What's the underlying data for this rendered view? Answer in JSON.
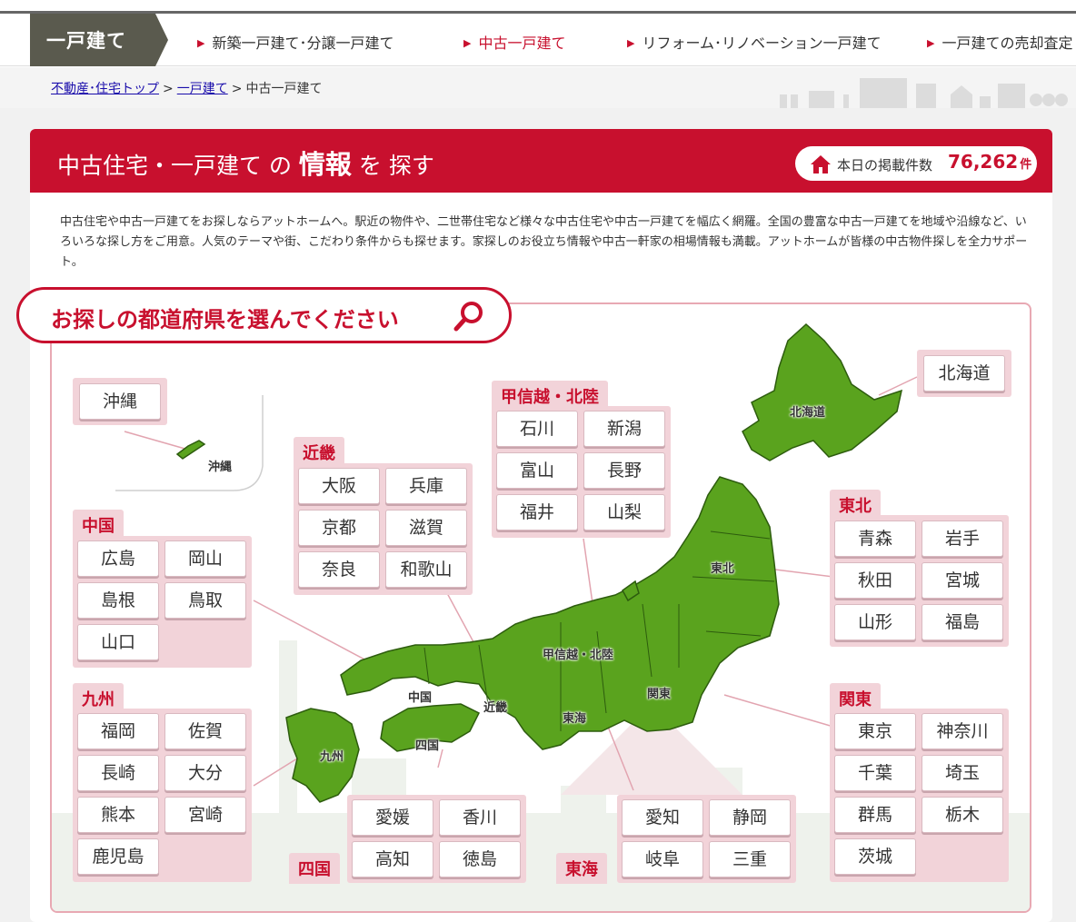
{
  "nav": {
    "title": "一戸建て",
    "links": [
      {
        "label": "新築一戸建て･分譲一戸建て",
        "active": false
      },
      {
        "label": "中古一戸建て",
        "active": true
      },
      {
        "label": "リフォーム･リノベーション一戸建て",
        "active": false
      },
      {
        "label": "一戸建ての売却査定",
        "active": false
      }
    ]
  },
  "breadcrumb": {
    "items": [
      "不動産･住宅トップ",
      "一戸建て",
      "中古一戸建て"
    ],
    "separator": ">"
  },
  "header": {
    "title_part1": "中古住宅・一戸建て の ",
    "title_big": "情報",
    "title_part2": " を 探す",
    "count_label": "本日の掲載件数",
    "count_value": "76,262",
    "count_unit": "件"
  },
  "description": "中古住宅や中古一戸建てをお探しならアットホームへ。駅近の物件や、二世帯住宅など様々な中古住宅や中古一戸建てを幅広く網羅。全国の豊富な中古一戸建てを地域や沿線など、いろいろな探し方をご用意。人気のテーマや街、こだわり条件からも探せます。家探しのお役立ち情報や中古一軒家の相場情報も満載。アットホームが皆様の中古物件探しを全力サポート。",
  "prompt": "お探しの都道府県を選んでください",
  "regions": {
    "okinawa": {
      "prefs": [
        "沖縄"
      ]
    },
    "hokkaido": {
      "prefs": [
        "北海道"
      ]
    },
    "chugoku": {
      "title": "中国",
      "prefs": [
        "広島",
        "岡山",
        "島根",
        "鳥取",
        "山口"
      ]
    },
    "kyushu": {
      "title": "九州",
      "prefs": [
        "福岡",
        "佐賀",
        "長崎",
        "大分",
        "熊本",
        "宮崎",
        "鹿児島"
      ]
    },
    "kinki": {
      "title": "近畿",
      "prefs": [
        "大阪",
        "兵庫",
        "京都",
        "滋賀",
        "奈良",
        "和歌山"
      ]
    },
    "koshinetsu": {
      "title": "甲信越・北陸",
      "prefs": [
        "石川",
        "新潟",
        "富山",
        "長野",
        "福井",
        "山梨"
      ]
    },
    "tohoku": {
      "title": "東北",
      "prefs": [
        "青森",
        "岩手",
        "秋田",
        "宮城",
        "山形",
        "福島"
      ]
    },
    "kanto": {
      "title": "関東",
      "prefs": [
        "東京",
        "神奈川",
        "千葉",
        "埼玉",
        "群馬",
        "栃木",
        "茨城"
      ]
    },
    "shikoku": {
      "title": "四国",
      "prefs": [
        "愛媛",
        "香川",
        "高知",
        "徳島"
      ]
    },
    "tokai": {
      "title": "東海",
      "prefs": [
        "愛知",
        "静岡",
        "岐阜",
        "三重"
      ]
    }
  },
  "map_labels": {
    "hokkaido": "北海道",
    "okinawa": "沖縄",
    "tohoku": "東北",
    "koshinetsu": "甲信越・北陸",
    "kanto": "関東",
    "tokai": "東海",
    "kinki": "近畿",
    "chugoku": "中国",
    "shikoku": "四国",
    "kyushu": "九州"
  },
  "colors": {
    "accent": "#c8102e",
    "map_green": "#5aa31e",
    "region_bg": "#f2d3d9"
  }
}
